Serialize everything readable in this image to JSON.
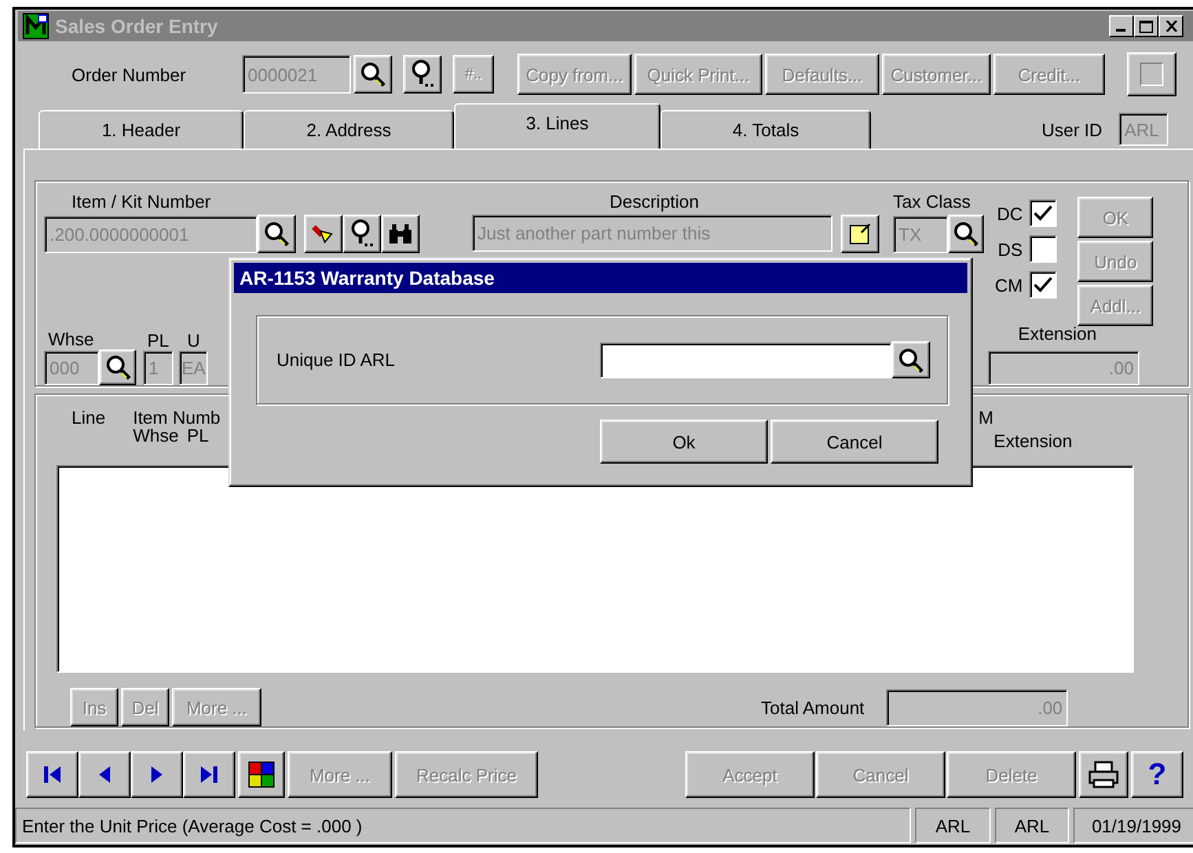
{
  "window": {
    "title": "Sales Order Entry"
  },
  "header": {
    "order_label": "Order Number",
    "order_number": "0000021",
    "number_button": "#..",
    "buttons": [
      {
        "label": "Copy from...",
        "disabled": true
      },
      {
        "label": "Quick Print...",
        "disabled": true
      },
      {
        "label": "Defaults...",
        "disabled": true
      },
      {
        "label": "Customer...",
        "disabled": true
      },
      {
        "label": "Credit...",
        "disabled": true
      }
    ]
  },
  "tabs": [
    {
      "label": "1. Header",
      "selected": false
    },
    {
      "label": "2. Address",
      "selected": false
    },
    {
      "label": "3. Lines",
      "selected": true
    },
    {
      "label": "4. Totals",
      "selected": false
    }
  ],
  "user_id": {
    "label": "User ID",
    "value": "ARL"
  },
  "line_entry": {
    "item_label": "Item / Kit Number",
    "item_value": ".200.0000000001",
    "description_label": "Description",
    "description_value": "Just another part number this",
    "tax_class_label": "Tax Class",
    "tax_class_value": "TX",
    "flags": [
      {
        "label": "DC",
        "checked": true
      },
      {
        "label": "DS",
        "checked": false
      },
      {
        "label": "CM",
        "checked": true
      }
    ],
    "buttons": [
      {
        "label": "OK",
        "disabled": true
      },
      {
        "label": "Undo",
        "disabled": true
      },
      {
        "label": "Addl...",
        "disabled": true
      }
    ],
    "whse_label": "Whse",
    "whse_value": "000",
    "pl_label": "PL",
    "pl_value": "1",
    "u_label": "U",
    "u_value": "EA",
    "extension_label": "Extension",
    "extension_value": ".00"
  },
  "lines_grid": {
    "line_label": "Line",
    "item_label": "Item Numb",
    "whse_label": "Whse",
    "pl_label": "PL",
    "cm_label": "M",
    "extension_label": "Extension",
    "buttons": [
      {
        "label": "Ins",
        "disabled": true
      },
      {
        "label": "Del",
        "disabled": true
      },
      {
        "label": "More ...",
        "disabled": true
      }
    ],
    "total_label": "Total Amount",
    "total_value": ".00"
  },
  "toolbar": {
    "buttons": [
      {
        "label": "More ...",
        "disabled": true
      },
      {
        "label": "Recalc Price",
        "disabled": true
      }
    ],
    "actions": [
      {
        "label": "Accept",
        "disabled": true
      },
      {
        "label": "Cancel",
        "disabled": true
      },
      {
        "label": "Delete",
        "disabled": true
      }
    ],
    "help": "?"
  },
  "status_bar": {
    "message": "Enter the Unit Price (Average Cost = .000 )",
    "cells": [
      "ARL",
      "ARL",
      "01/19/1999"
    ]
  },
  "dialog": {
    "title": "AR-1153 Warranty Database",
    "field_label": "Unique ID ARL",
    "buttons": [
      "Ok",
      "Cancel"
    ]
  }
}
